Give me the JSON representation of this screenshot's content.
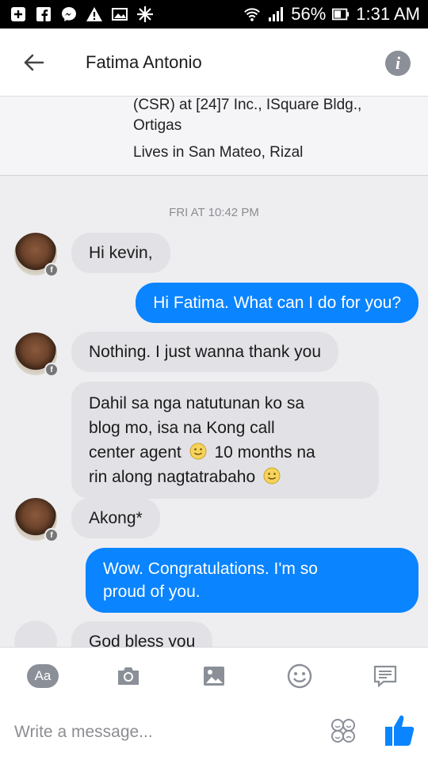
{
  "statusbar": {
    "battery": "56%",
    "time": "1:31 AM",
    "icons": [
      "add-box-icon",
      "facebook-icon",
      "messenger-icon",
      "warning-icon",
      "photo-icon",
      "sync-icon",
      "wifi-icon",
      "signal-icon",
      "battery-icon"
    ]
  },
  "header": {
    "title": "Fatima Antonio",
    "back_icon": "arrow-left-icon",
    "info_icon": "info-icon",
    "info_glyph": "i"
  },
  "profile": {
    "line1": "(CSR) at [24]7 Inc., ISquare Bldg.,",
    "line2": "Ortigas",
    "line3": "Lives in San Mateo, Rizal"
  },
  "conversation": {
    "timestamp": "FRI AT 10:42 PM",
    "messages": [
      {
        "from": "them",
        "text": "Hi kevin,"
      },
      {
        "from": "me",
        "text": "Hi Fatima. What can I do for you?"
      },
      {
        "from": "them",
        "text": "Nothing. I just wanna thank you"
      },
      {
        "from": "them",
        "lines": [
          "Dahil sa nga natutunan ko sa",
          "blog mo, isa na Kong call",
          "center agent",
          "10 months na",
          "rin along nagtatrabaho"
        ]
      },
      {
        "from": "them",
        "text": "Akong*"
      },
      {
        "from": "me",
        "lines": [
          "Wow. Congratulations. I'm so",
          "proud of you."
        ]
      },
      {
        "from": "them",
        "text": "God bless you"
      }
    ],
    "badge_glyph": "f"
  },
  "composer": {
    "aa_label": "Aa",
    "placeholder": "Write a message...",
    "tools": [
      "text-format-icon",
      "camera-icon",
      "gallery-icon",
      "emoji-icon",
      "message-icon"
    ],
    "like_icon": "thumbs-up-icon",
    "sticker_icon": "stickers-icon"
  },
  "colors": {
    "outgoing": "#0a84ff",
    "incoming": "#e2e2e6",
    "like": "#0a84ff"
  }
}
